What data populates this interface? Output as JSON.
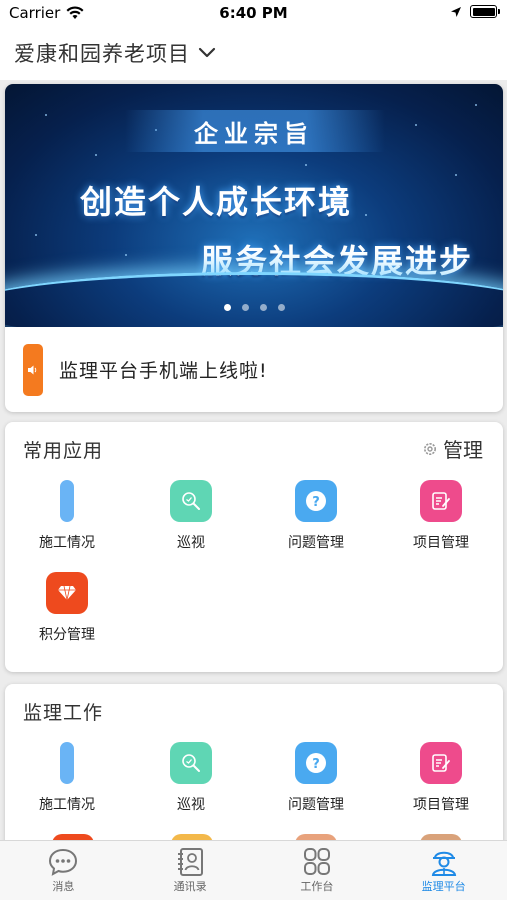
{
  "status_bar": {
    "carrier": "Carrier",
    "time": "6:40 PM"
  },
  "header": {
    "project_name": "爱康和园养老项目"
  },
  "banner": {
    "tag": "企业宗旨",
    "line1": "创造个人成长环境",
    "line2": "服务社会发展进步",
    "page_count": 4,
    "active_page": 1
  },
  "notice": {
    "text": "监理平台手机端上线啦!"
  },
  "common_apps": {
    "title": "常用应用",
    "manage_label": "管理",
    "items": [
      {
        "label": "施工情况",
        "icon": "construction-icon",
        "color": "#6ab4f5"
      },
      {
        "label": "巡视",
        "icon": "inspect-icon",
        "color": "#5fd6b4"
      },
      {
        "label": "问题管理",
        "icon": "question-icon",
        "color": "#4aa9f0"
      },
      {
        "label": "项目管理",
        "icon": "edit-doc-icon",
        "color": "#ee4b8c"
      },
      {
        "label": "积分管理",
        "icon": "diamond-icon",
        "color": "#ee4a1e"
      }
    ]
  },
  "supervision_work": {
    "title": "监理工作",
    "items": [
      {
        "label": "施工情况",
        "icon": "construction-icon",
        "color": "#6ab4f5"
      },
      {
        "label": "巡视",
        "icon": "inspect-icon",
        "color": "#5fd6b4"
      },
      {
        "label": "问题管理",
        "icon": "question-icon",
        "color": "#4aa9f0"
      },
      {
        "label": "项目管理",
        "icon": "edit-doc-icon",
        "color": "#ee4b8c"
      }
    ]
  },
  "tab_bar": {
    "items": [
      {
        "label": "消息",
        "icon": "chat-icon"
      },
      {
        "label": "通讯录",
        "icon": "contacts-icon"
      },
      {
        "label": "工作台",
        "icon": "grid-icon"
      },
      {
        "label": "监理平台",
        "icon": "supervisor-icon",
        "active": true
      }
    ]
  },
  "colors": {
    "accent": "#1f8ae6",
    "notice_accent": "#f47a1f"
  }
}
